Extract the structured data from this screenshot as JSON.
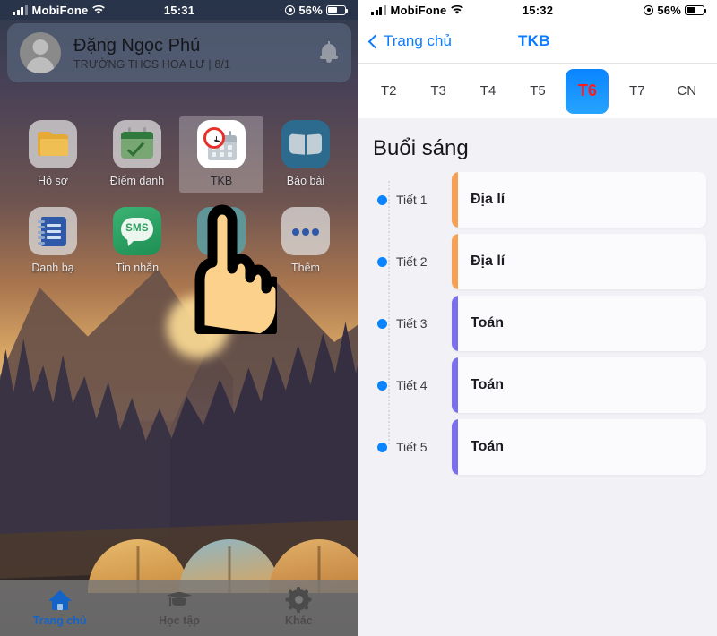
{
  "left_screen": {
    "status_bar": {
      "carrier": "MobiFone",
      "time": "15:31",
      "battery_percent": "56%",
      "signal_icon": "signal-bars-icon",
      "wifi_icon": "wifi-icon",
      "location_icon": "location-services-icon",
      "battery_icon": "battery-icon"
    },
    "profile": {
      "name": "Đặng Ngọc Phú",
      "school": "TRƯỜNG THCS HOA LƯ | 8/1",
      "avatar_icon": "avatar-placeholder-icon",
      "bell_icon": "notification-bell-icon"
    },
    "apps": [
      {
        "label": "Hồ sơ",
        "icon": "folder-icon",
        "highlighted": false
      },
      {
        "label": "Điểm danh",
        "icon": "calendar-check-icon",
        "highlighted": false
      },
      {
        "label": "TKB",
        "icon": "clock-calendar-icon",
        "highlighted": true
      },
      {
        "label": "Báo bài",
        "icon": "open-book-icon",
        "highlighted": false
      },
      {
        "label": "Danh bạ",
        "icon": "contact-notebook-icon",
        "highlighted": false
      },
      {
        "label": "Tin nhắn",
        "icon": "sms-bubble-icon",
        "highlighted": false
      },
      {
        "label": "",
        "icon": "hidden-app-icon",
        "highlighted": false
      },
      {
        "label": "Thêm",
        "icon": "more-dots-icon",
        "highlighted": false
      }
    ],
    "sms_icon_text": "SMS",
    "cursor_icon": "pointing-hand-cursor",
    "tabbar": [
      {
        "label": "Trang chủ",
        "icon": "home-icon",
        "active": true
      },
      {
        "label": "Học tập",
        "icon": "graduation-cap-icon",
        "active": false
      },
      {
        "label": "Khác",
        "icon": "gear-icon",
        "active": false
      }
    ]
  },
  "right_screen": {
    "status_bar": {
      "carrier": "MobiFone",
      "time": "15:32",
      "battery_percent": "56%",
      "signal_icon": "signal-bars-icon",
      "wifi_icon": "wifi-icon",
      "location_icon": "location-services-icon",
      "battery_icon": "battery-icon"
    },
    "navbar": {
      "back_label": "Trang chủ",
      "back_icon": "chevron-left-icon",
      "title": "TKB"
    },
    "days": [
      {
        "label": "T2",
        "selected": false
      },
      {
        "label": "T3",
        "selected": false
      },
      {
        "label": "T4",
        "selected": false
      },
      {
        "label": "T5",
        "selected": false
      },
      {
        "label": "T6",
        "selected": true
      },
      {
        "label": "T7",
        "selected": false
      },
      {
        "label": "CN",
        "selected": false
      }
    ],
    "session_title": "Buổi sáng",
    "slots": [
      {
        "period": "Tiết 1",
        "subject": "Địa lí",
        "color": "#f5a053"
      },
      {
        "period": "Tiết 2",
        "subject": "Địa lí",
        "color": "#f5a053"
      },
      {
        "period": "Tiết 3",
        "subject": "Toán",
        "color": "#7b6ff0"
      },
      {
        "period": "Tiết 4",
        "subject": "Toán",
        "color": "#7b6ff0"
      },
      {
        "period": "Tiết 5",
        "subject": "Toán",
        "color": "#7b6ff0"
      }
    ]
  },
  "colors": {
    "accent_blue": "#0a84ff",
    "selected_day_text": "#ff1a1a",
    "subject_geography": "#f5a053",
    "subject_math": "#7b6ff0"
  }
}
